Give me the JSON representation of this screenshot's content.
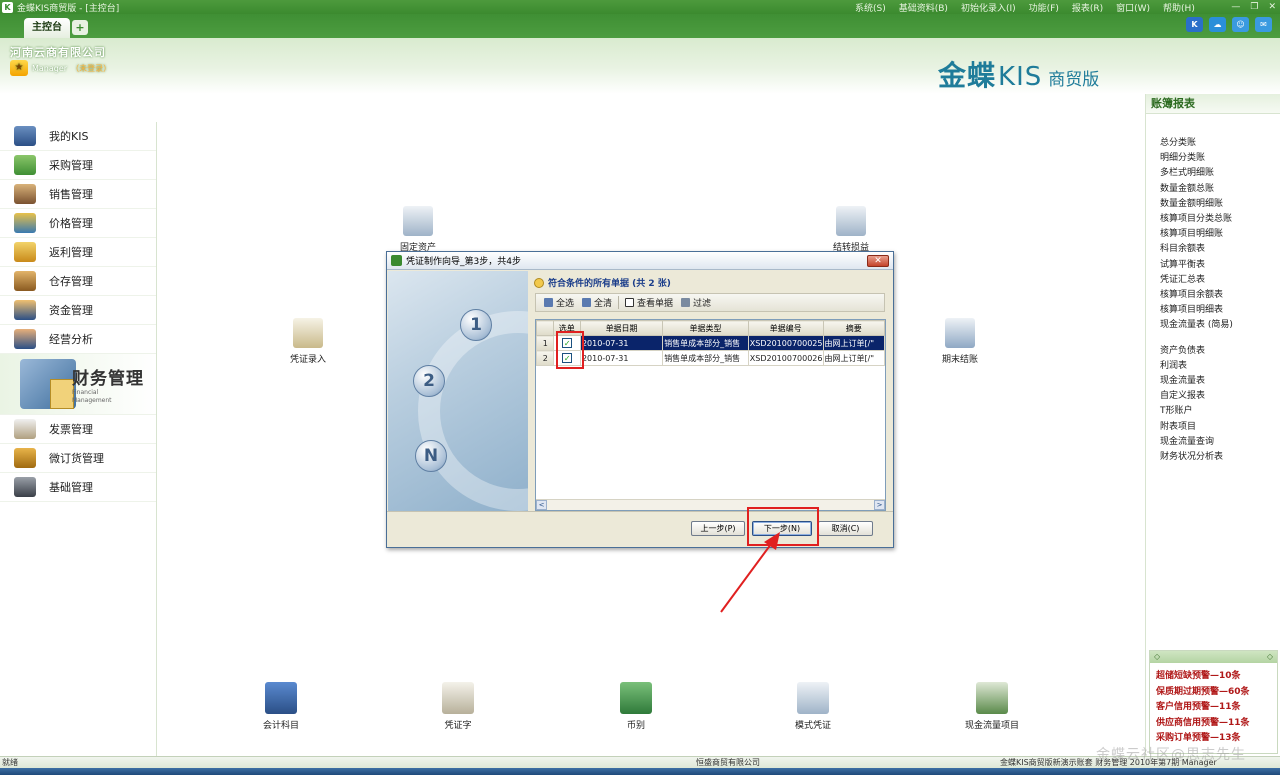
{
  "window": {
    "title": "金蝶KIS商贸版 - [主控台]",
    "menus": [
      "系统(S)",
      "基础资料(B)",
      "初始化录入(I)",
      "功能(F)",
      "报表(R)",
      "窗口(W)",
      "帮助(H)"
    ]
  },
  "tabs": {
    "main": "主控台",
    "add": "+"
  },
  "header": {
    "company": "河南云商有限公司",
    "user": "Manager",
    "user_status": "（未登录）",
    "brand_main": "金蝶",
    "brand_kis": "KIS",
    "brand_edition": "商贸版",
    "top_icons": [
      "K",
      "☁",
      "☺",
      "✉"
    ]
  },
  "nav": {
    "items": [
      "我的KIS",
      "采购管理",
      "销售管理",
      "价格管理",
      "返利管理",
      "仓存管理",
      "资金管理",
      "经营分析"
    ],
    "active_title": "财务管理",
    "active_en_1": "Financial",
    "active_en_2": "Management",
    "items_after": [
      "发票管理",
      "微订货管理",
      "基础管理"
    ]
  },
  "main": {
    "icons": {
      "voucher_entry": "凭证录入",
      "fixed_assets": "固定资产",
      "carry_forward": "结转损益",
      "period_close": "期末结账"
    },
    "bottom_icons": [
      "会计科目",
      "凭证字",
      "币别",
      "模式凭证",
      "现金流量项目"
    ]
  },
  "right_panel": {
    "title": "账簿报表",
    "group1": [
      "总分类账",
      "明细分类账",
      "多栏式明细账",
      "数量金额总账",
      "数量金额明细账",
      "核算项目分类总账",
      "核算项目明细账",
      "科目余额表",
      "试算平衡表",
      "凭证汇总表",
      "核算项目余额表",
      "核算项目明细表",
      "现金流量表 (简易)"
    ],
    "group2": [
      "资产负债表",
      "利润表",
      "现金流量表",
      "自定义报表",
      "T形账户",
      "附表项目",
      "现金流量查询",
      "财务状况分析表"
    ],
    "warn_head_left": "◇",
    "warn_head_right": "◇",
    "warnings": [
      "超储短缺预警—10条",
      "保质期过期预警—60条",
      "客户信用预警—11条",
      "供应商信用预警—11条",
      "采购订单预警—13条"
    ]
  },
  "dialog": {
    "title": "凭证制作向导_第3步，共4步",
    "close": "✕",
    "steps": [
      "1",
      "2",
      "N"
    ],
    "subtitle": "符合条件的所有单据 (共 2 张)",
    "toolbar": {
      "select_all": "全选",
      "clear_all": "全清",
      "view_doc": "查看单据",
      "filter": "过滤"
    },
    "columns": [
      "选单",
      "单据日期",
      "单据类型",
      "单据编号",
      "摘要"
    ],
    "rows": [
      {
        "num": "1",
        "checked": "✓",
        "date": "2010-07-31",
        "type": "销售单成本部分_销售",
        "code": "XSD20100700025",
        "summary": "由网上订单[/\""
      },
      {
        "num": "2",
        "checked": "✓",
        "date": "2010-07-31",
        "type": "销售单成本部分_销售",
        "code": "XSD20100700026",
        "summary": "由网上订单[/\""
      }
    ],
    "buttons": {
      "prev": "上一步(P)",
      "next": "下一步(N)",
      "cancel": "取消(C)"
    },
    "scroll_left": "<",
    "scroll_right": ">"
  },
  "statusbar": {
    "left": "就绪",
    "center": "恒盛商贸有限公司",
    "right": "金蝶KIS商贸版新演示账套  财务管理  2010年第7期  Manager"
  },
  "watermark": "金蝶云社区@思志先生",
  "colors": {
    "green": "#3b8a2f",
    "brand_blue": "#1f7c9a",
    "annotation_red": "#e02020",
    "selection": "#0a246a"
  }
}
